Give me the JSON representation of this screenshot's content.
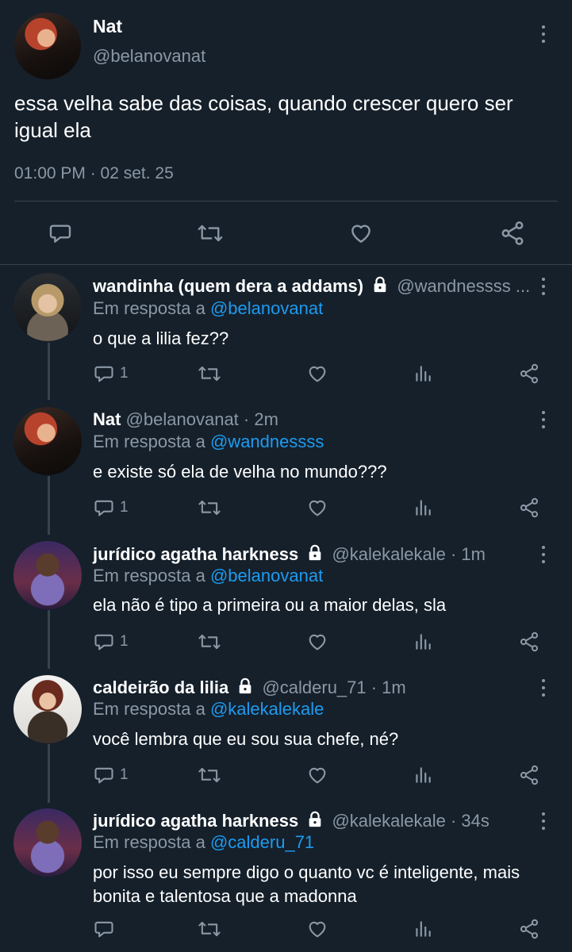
{
  "main": {
    "name": "Nat",
    "handle": "@belanovanat",
    "text": "essa velha sabe das coisas, quando crescer quero ser igual ela",
    "timestamp": "01:00 PM · 02 set. 25"
  },
  "replies": [
    {
      "name": "wandinha (quem dera a addams)",
      "handle": "@wandnessss ...",
      "time": "",
      "locked": true,
      "reply_label": "Em resposta a",
      "reply_to": "@belanovanat",
      "text": "o que a lilia fez??",
      "reply_count": "1"
    },
    {
      "name": "Nat",
      "handle": "@belanovanat · 2m",
      "time": "",
      "locked": false,
      "reply_label": "Em resposta a",
      "reply_to": "@wandnessss",
      "text": "e existe só ela de velha no mundo???",
      "reply_count": "1"
    },
    {
      "name": "jurídico agatha harkness",
      "handle": "@kalekalekale · 1m",
      "locked": true,
      "reply_label": "Em resposta a",
      "reply_to": "@belanovanat",
      "text": "ela não é tipo a primeira ou a maior delas, sla",
      "reply_count": "1"
    },
    {
      "name": "caldeirão da lilia",
      "handle": "@calderu_71 · 1m",
      "locked": true,
      "reply_label": "Em resposta a",
      "reply_to": "@kalekalekale",
      "text": "você lembra que eu sou sua chefe, né?",
      "reply_count": "1"
    },
    {
      "name": "jurídico agatha harkness",
      "handle": "@kalekalekale · 34s",
      "locked": true,
      "reply_label": "Em resposta a",
      "reply_to": "@calderu_71",
      "text": "por isso eu sempre digo o quanto vc é inteligente, mais bonita e talentosa que a madonna",
      "reply_count": ""
    }
  ],
  "icons": {
    "reply": "speech-bubble-icon",
    "retweet": "retweet-icon",
    "like": "heart-icon",
    "share": "share-icon",
    "analytics": "analytics-icon",
    "more": "more-vertical-icon",
    "lock": "lock-icon"
  },
  "colors": {
    "background": "#15202b",
    "muted": "#8b98a5",
    "link": "#1d9bf0",
    "divider": "#38444d"
  }
}
